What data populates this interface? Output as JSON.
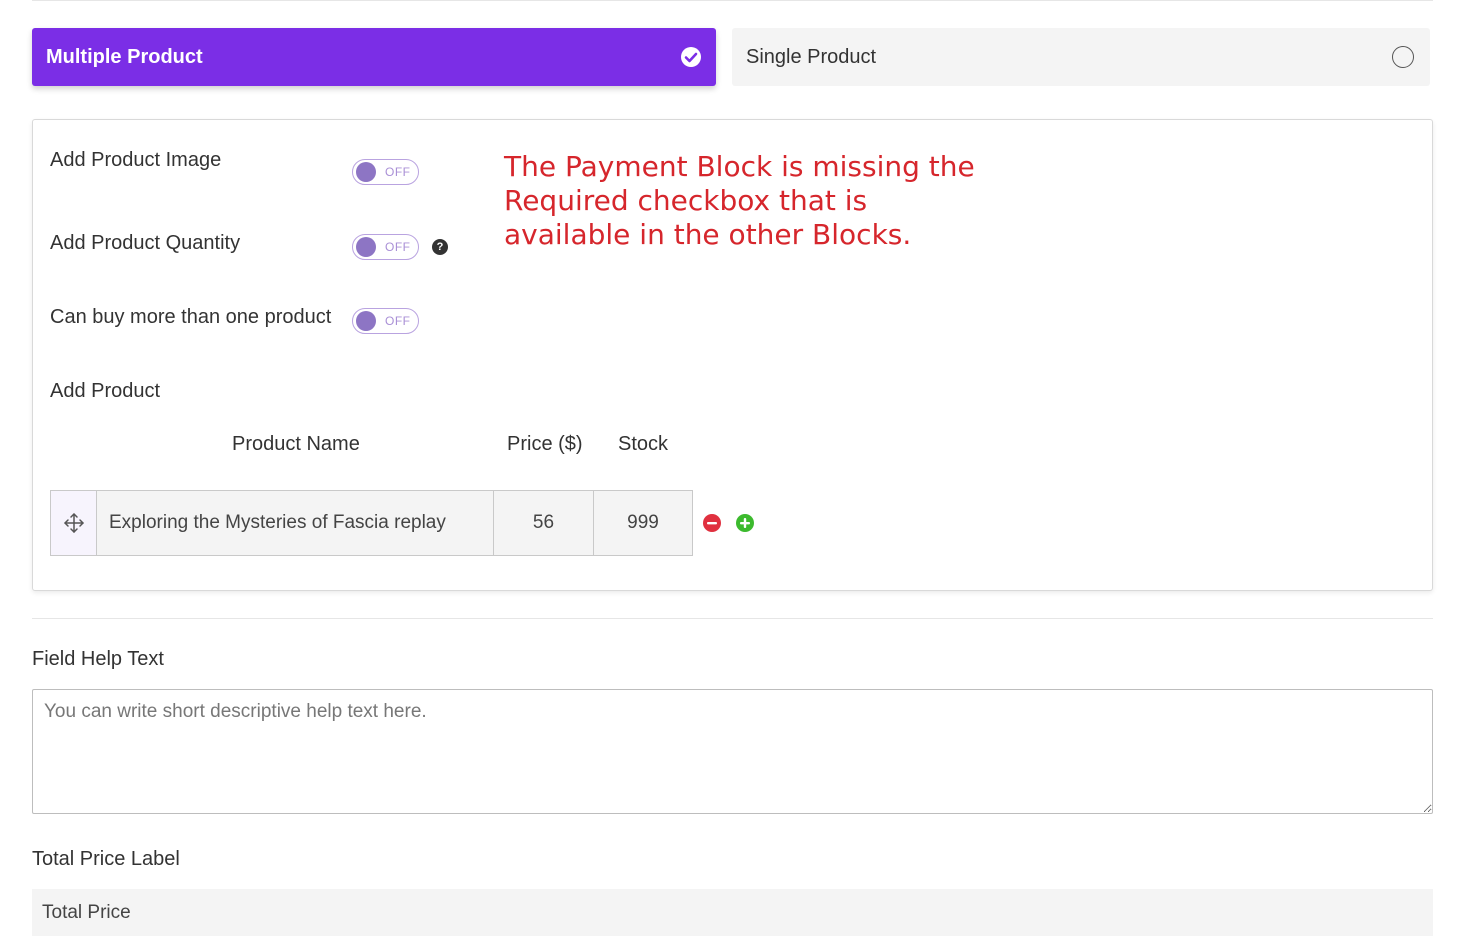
{
  "product_type": {
    "multiple_label": "Multiple Product",
    "single_label": "Single Product",
    "selected": "multiple",
    "accent_color": "#7b2ee6"
  },
  "options": [
    {
      "label": "Add Product Image",
      "state": "OFF"
    },
    {
      "label": "Add Product Quantity",
      "state": "OFF",
      "help": "?"
    },
    {
      "label": "Can buy more than one product",
      "state": "OFF"
    }
  ],
  "annotation": "The Payment Block is missing the Required checkbox that is available in the other Blocks.",
  "add_product": {
    "title": "Add Product",
    "headers": {
      "name": "Product Name",
      "price": "Price ($)",
      "stock": "Stock"
    },
    "rows": [
      {
        "name": "Exploring the Mysteries of Fascia replay",
        "price": "56",
        "stock": "999"
      }
    ]
  },
  "field_help": {
    "label": "Field Help Text",
    "placeholder": "You can write short descriptive help text here."
  },
  "total_price": {
    "label": "Total Price Label",
    "value": "Total Price"
  }
}
